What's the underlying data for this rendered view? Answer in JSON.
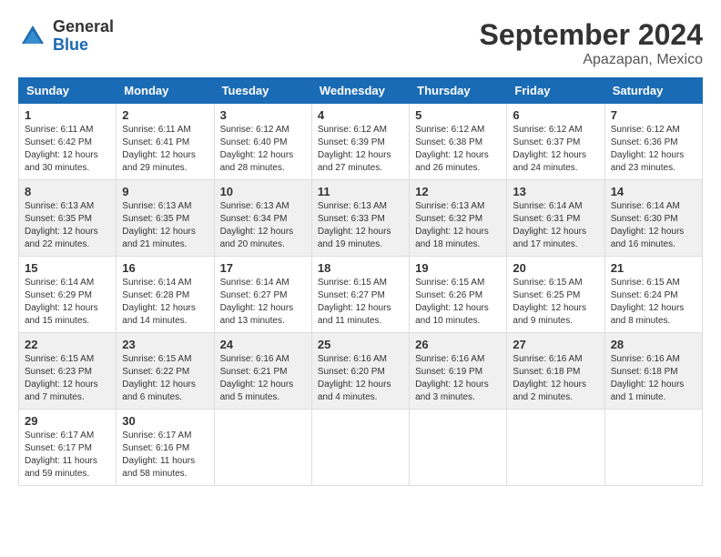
{
  "header": {
    "logo_general": "General",
    "logo_blue": "Blue",
    "month_title": "September 2024",
    "location": "Apazapan, Mexico"
  },
  "weekdays": [
    "Sunday",
    "Monday",
    "Tuesday",
    "Wednesday",
    "Thursday",
    "Friday",
    "Saturday"
  ],
  "weeks": [
    [
      {
        "day": "1",
        "sunrise": "6:11 AM",
        "sunset": "6:42 PM",
        "daylight": "12 hours and 30 minutes."
      },
      {
        "day": "2",
        "sunrise": "6:11 AM",
        "sunset": "6:41 PM",
        "daylight": "12 hours and 29 minutes."
      },
      {
        "day": "3",
        "sunrise": "6:12 AM",
        "sunset": "6:40 PM",
        "daylight": "12 hours and 28 minutes."
      },
      {
        "day": "4",
        "sunrise": "6:12 AM",
        "sunset": "6:39 PM",
        "daylight": "12 hours and 27 minutes."
      },
      {
        "day": "5",
        "sunrise": "6:12 AM",
        "sunset": "6:38 PM",
        "daylight": "12 hours and 26 minutes."
      },
      {
        "day": "6",
        "sunrise": "6:12 AM",
        "sunset": "6:37 PM",
        "daylight": "12 hours and 24 minutes."
      },
      {
        "day": "7",
        "sunrise": "6:12 AM",
        "sunset": "6:36 PM",
        "daylight": "12 hours and 23 minutes."
      }
    ],
    [
      {
        "day": "8",
        "sunrise": "6:13 AM",
        "sunset": "6:35 PM",
        "daylight": "12 hours and 22 minutes."
      },
      {
        "day": "9",
        "sunrise": "6:13 AM",
        "sunset": "6:35 PM",
        "daylight": "12 hours and 21 minutes."
      },
      {
        "day": "10",
        "sunrise": "6:13 AM",
        "sunset": "6:34 PM",
        "daylight": "12 hours and 20 minutes."
      },
      {
        "day": "11",
        "sunrise": "6:13 AM",
        "sunset": "6:33 PM",
        "daylight": "12 hours and 19 minutes."
      },
      {
        "day": "12",
        "sunrise": "6:13 AM",
        "sunset": "6:32 PM",
        "daylight": "12 hours and 18 minutes."
      },
      {
        "day": "13",
        "sunrise": "6:14 AM",
        "sunset": "6:31 PM",
        "daylight": "12 hours and 17 minutes."
      },
      {
        "day": "14",
        "sunrise": "6:14 AM",
        "sunset": "6:30 PM",
        "daylight": "12 hours and 16 minutes."
      }
    ],
    [
      {
        "day": "15",
        "sunrise": "6:14 AM",
        "sunset": "6:29 PM",
        "daylight": "12 hours and 15 minutes."
      },
      {
        "day": "16",
        "sunrise": "6:14 AM",
        "sunset": "6:28 PM",
        "daylight": "12 hours and 14 minutes."
      },
      {
        "day": "17",
        "sunrise": "6:14 AM",
        "sunset": "6:27 PM",
        "daylight": "12 hours and 13 minutes."
      },
      {
        "day": "18",
        "sunrise": "6:15 AM",
        "sunset": "6:27 PM",
        "daylight": "12 hours and 11 minutes."
      },
      {
        "day": "19",
        "sunrise": "6:15 AM",
        "sunset": "6:26 PM",
        "daylight": "12 hours and 10 minutes."
      },
      {
        "day": "20",
        "sunrise": "6:15 AM",
        "sunset": "6:25 PM",
        "daylight": "12 hours and 9 minutes."
      },
      {
        "day": "21",
        "sunrise": "6:15 AM",
        "sunset": "6:24 PM",
        "daylight": "12 hours and 8 minutes."
      }
    ],
    [
      {
        "day": "22",
        "sunrise": "6:15 AM",
        "sunset": "6:23 PM",
        "daylight": "12 hours and 7 minutes."
      },
      {
        "day": "23",
        "sunrise": "6:15 AM",
        "sunset": "6:22 PM",
        "daylight": "12 hours and 6 minutes."
      },
      {
        "day": "24",
        "sunrise": "6:16 AM",
        "sunset": "6:21 PM",
        "daylight": "12 hours and 5 minutes."
      },
      {
        "day": "25",
        "sunrise": "6:16 AM",
        "sunset": "6:20 PM",
        "daylight": "12 hours and 4 minutes."
      },
      {
        "day": "26",
        "sunrise": "6:16 AM",
        "sunset": "6:19 PM",
        "daylight": "12 hours and 3 minutes."
      },
      {
        "day": "27",
        "sunrise": "6:16 AM",
        "sunset": "6:18 PM",
        "daylight": "12 hours and 2 minutes."
      },
      {
        "day": "28",
        "sunrise": "6:16 AM",
        "sunset": "6:18 PM",
        "daylight": "12 hours and 1 minute."
      }
    ],
    [
      {
        "day": "29",
        "sunrise": "6:17 AM",
        "sunset": "6:17 PM",
        "daylight": "11 hours and 59 minutes."
      },
      {
        "day": "30",
        "sunrise": "6:17 AM",
        "sunset": "6:16 PM",
        "daylight": "11 hours and 58 minutes."
      },
      null,
      null,
      null,
      null,
      null
    ]
  ]
}
